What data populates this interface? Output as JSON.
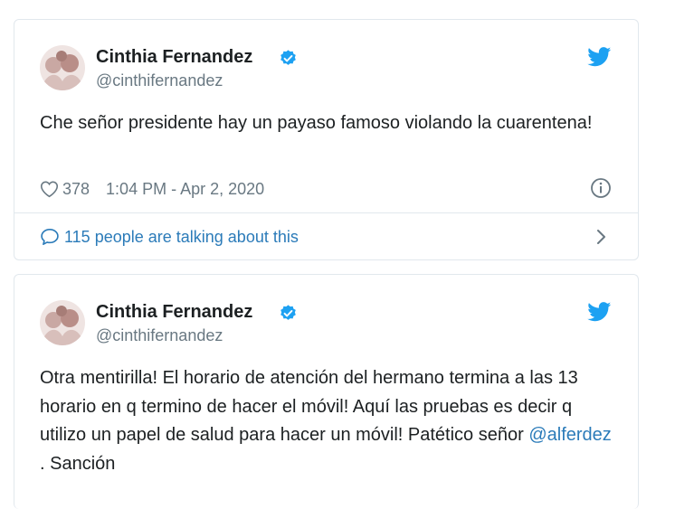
{
  "tweets": [
    {
      "author_name": "Cinthia Fernandez",
      "author_handle": "@cinthifernandez",
      "text": "Che señor presidente hay un payaso famoso violando la cuarentena!",
      "likes": "378",
      "timestamp": "1:04 PM - Apr 2, 2020",
      "talking": "115 people are talking about this"
    },
    {
      "author_name": "Cinthia Fernandez",
      "author_handle": "@cinthifernandez",
      "text_before": "Otra mentirilla! El horario de atención del hermano termina a las 13 horario en q termino de hacer el móvil! Aquí las pruebas es decir q utilizo un papel de salud para hacer un móvil! Patético señor ",
      "mention": "@alferdez",
      "text_after": " . Sanción"
    }
  ],
  "colors": {
    "link": "#2b7bb9",
    "verified": "#1da1f2",
    "muted": "#697882",
    "border": "#e1e8ed"
  },
  "icons": [
    "twitter-bird-icon",
    "verified-badge-icon",
    "heart-icon",
    "info-icon",
    "comment-bubble-icon",
    "chevron-right-icon"
  ]
}
